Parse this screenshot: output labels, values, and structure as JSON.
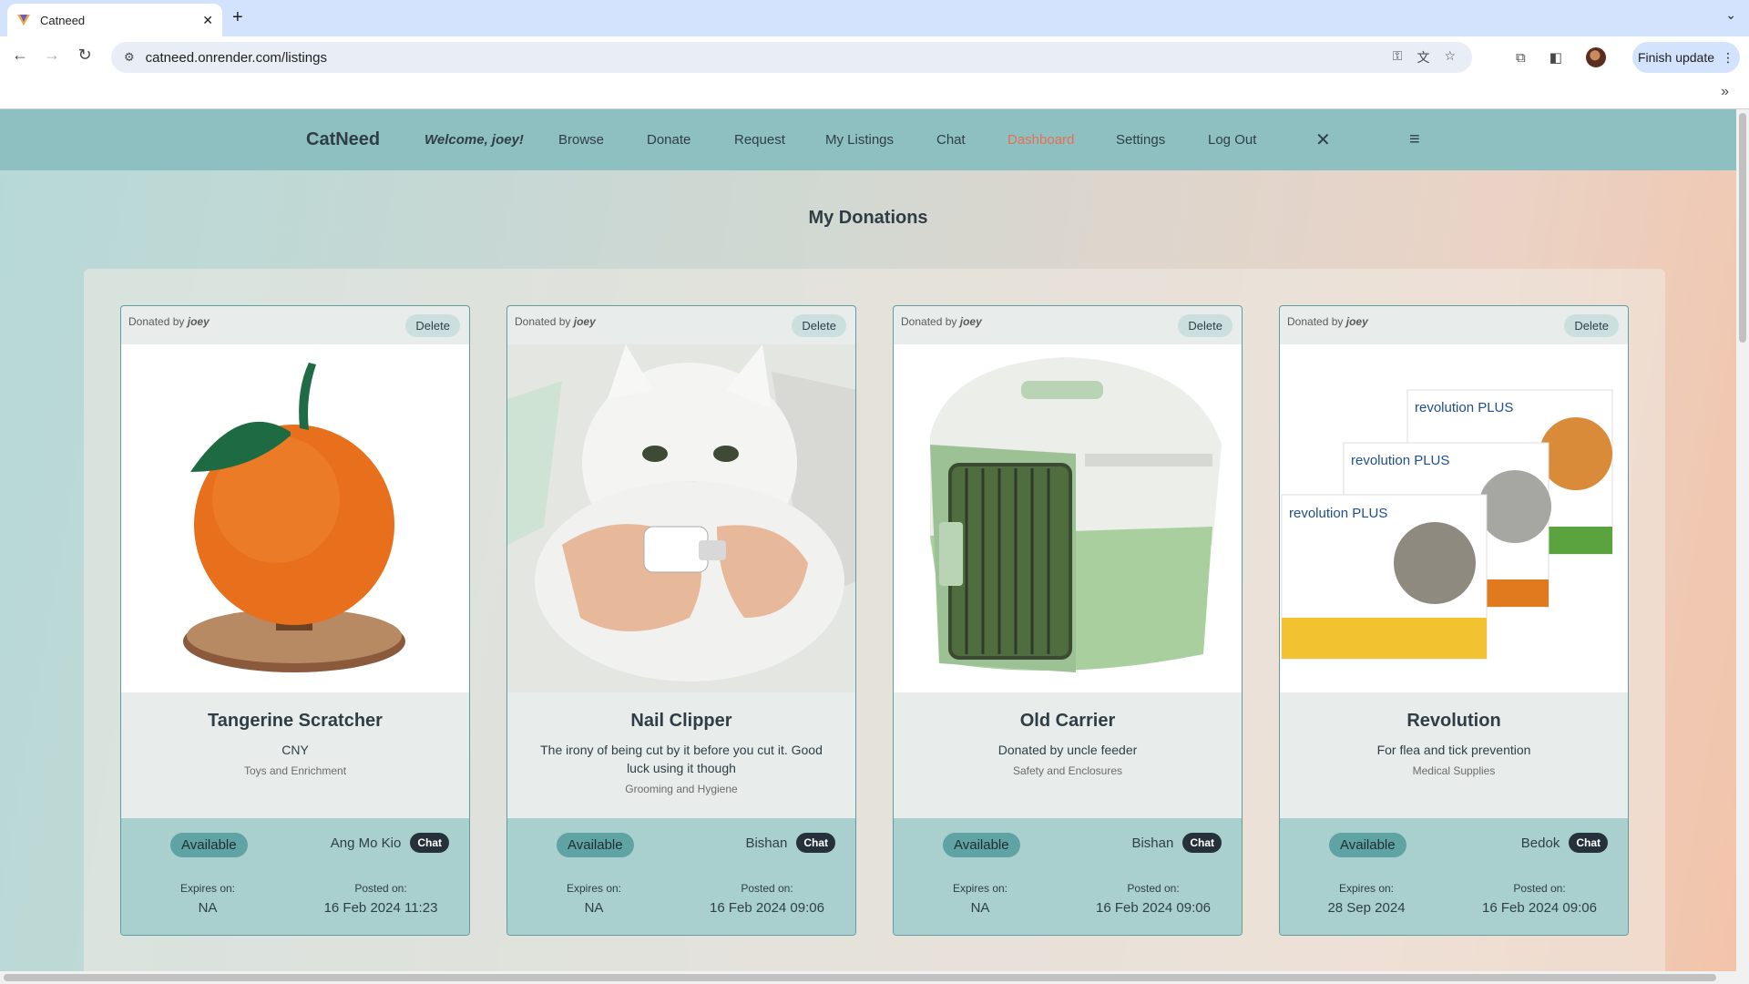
{
  "browser": {
    "tab_title": "Catneed",
    "url": "catneed.onrender.com/listings",
    "update_label": "Finish update"
  },
  "nav": {
    "brand": "CatNeed",
    "welcome": "Welcome, joey!",
    "links": [
      "Browse",
      "Donate",
      "Request",
      "My Listings",
      "Chat",
      "Dashboard",
      "Settings",
      "Log Out"
    ],
    "active": "Dashboard"
  },
  "heading": "My Donations",
  "common": {
    "donated_by": "Donated by",
    "delete_label": "Delete",
    "chat_label": "Chat",
    "expires_label": "Expires on:",
    "posted_label": "Posted on:"
  },
  "cards": [
    {
      "donor": "joey",
      "title": "Tangerine Scratcher",
      "description": "CNY",
      "category": "Toys and Enrichment",
      "status": "Available",
      "location": "Ang Mo Kio",
      "expires": "NA",
      "posted": "16 Feb 2024 11:23",
      "image": "orange-scratcher-image"
    },
    {
      "donor": "joey",
      "title": "Nail Clipper",
      "description": "The irony of being cut by it before you cut it. Good luck using it though",
      "category": "Grooming and Hygiene",
      "status": "Available",
      "location": "Bishan",
      "expires": "NA",
      "posted": "16 Feb 2024 09:06",
      "image": "cat-nail-clipper-image"
    },
    {
      "donor": "joey",
      "title": "Old Carrier",
      "description": "Donated by uncle feeder",
      "category": "Safety and Enclosures",
      "status": "Available",
      "location": "Bishan",
      "expires": "NA",
      "posted": "16 Feb 2024 09:06",
      "image": "pet-carrier-image"
    },
    {
      "donor": "joey",
      "title": "Revolution",
      "description": "For flea and tick prevention",
      "category": "Medical Supplies",
      "status": "Available",
      "location": "Bedok",
      "expires": "28 Sep 2024",
      "posted": "16 Feb 2024 09:06",
      "image": "revolution-plus-boxes-image",
      "product_texts": [
        "revolution PLUS",
        "revolution PLUS",
        "revolution PLUS"
      ]
    }
  ]
}
